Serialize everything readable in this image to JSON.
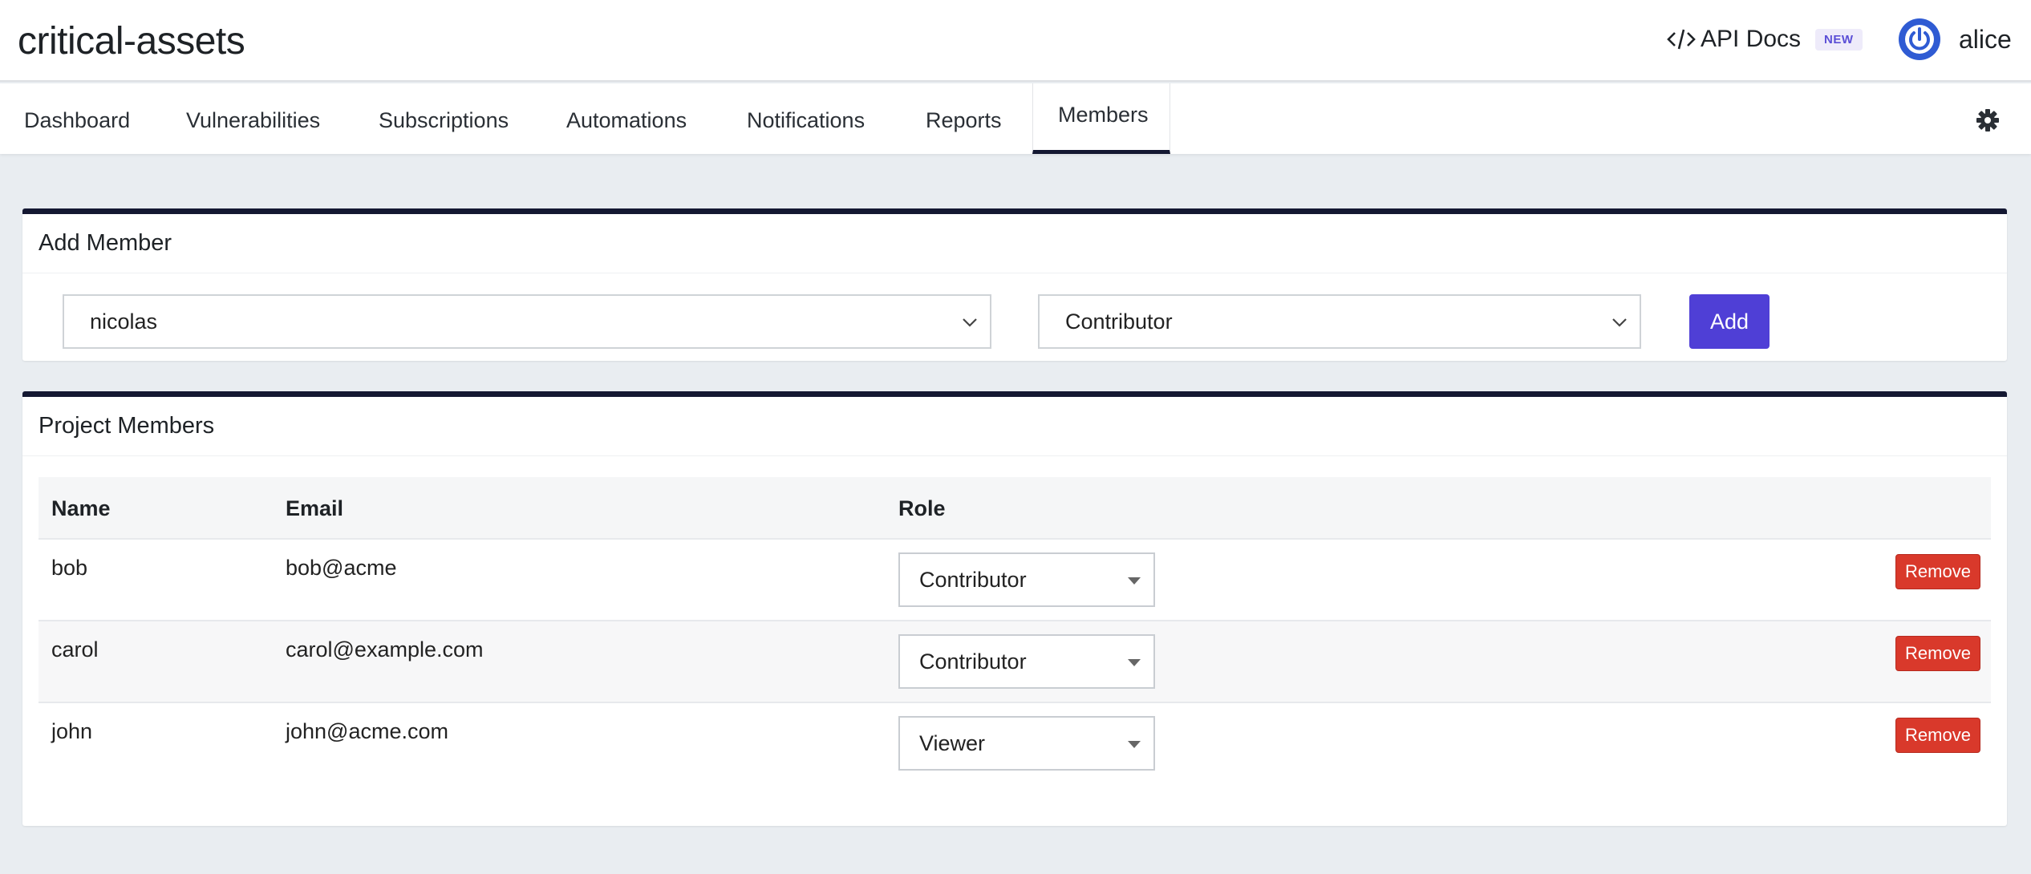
{
  "header": {
    "project_title": "critical-assets",
    "api_docs_label": "API Docs",
    "new_badge": "NEW",
    "username": "alice"
  },
  "nav": {
    "tabs": [
      {
        "label": "Dashboard"
      },
      {
        "label": "Vulnerabilities"
      },
      {
        "label": "Subscriptions"
      },
      {
        "label": "Automations"
      },
      {
        "label": "Notifications"
      },
      {
        "label": "Reports"
      },
      {
        "label": "Members",
        "active": true
      }
    ],
    "settings_icon": "gear-icon"
  },
  "add_member": {
    "title": "Add Member",
    "user_select_value": "nicolas",
    "role_select_value": "Contributor",
    "add_label": "Add"
  },
  "members": {
    "title": "Project Members",
    "columns": [
      "Name",
      "Email",
      "Role"
    ],
    "rows": [
      {
        "name": "bob",
        "email": "bob@acme",
        "role": "Contributor",
        "remove_label": "Remove"
      },
      {
        "name": "carol",
        "email": "carol@example.com",
        "role": "Contributor",
        "remove_label": "Remove"
      },
      {
        "name": "john",
        "email": "john@acme.com",
        "role": "Viewer",
        "remove_label": "Remove"
      }
    ]
  },
  "colors": {
    "accent": "#4f3fd6",
    "danger": "#d9392b",
    "panel_border": "#141832",
    "background": "#e9edf1"
  }
}
